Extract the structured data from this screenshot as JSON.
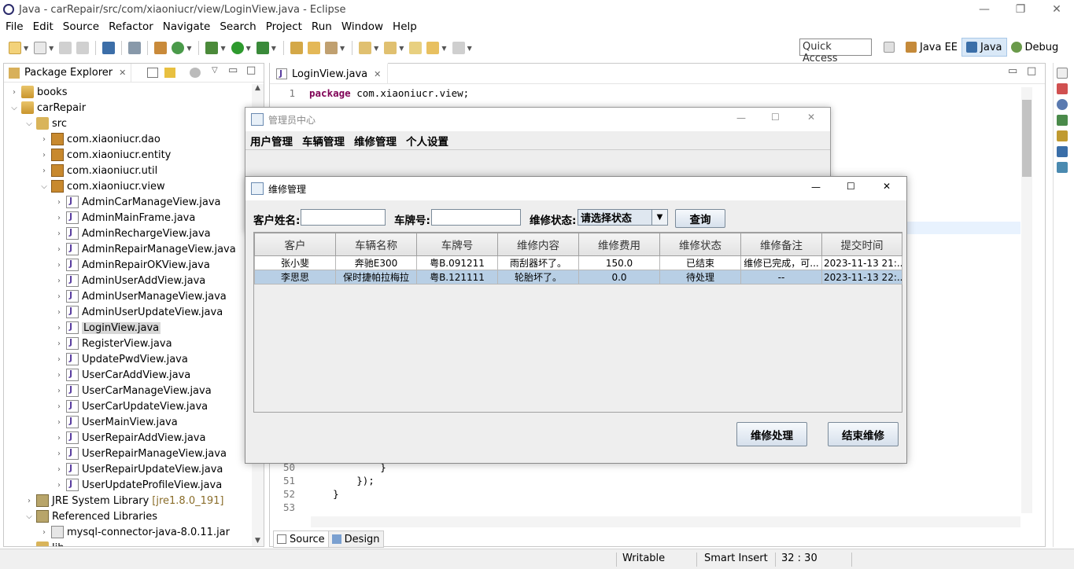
{
  "window": {
    "title": "Java - carRepair/src/com/xiaoniucr/view/LoginView.java - Eclipse"
  },
  "menu": [
    "File",
    "Edit",
    "Source",
    "Refactor",
    "Navigate",
    "Search",
    "Project",
    "Run",
    "Window",
    "Help"
  ],
  "quick_access": "Quick Access",
  "perspectives": [
    {
      "label": "Java EE",
      "active": false
    },
    {
      "label": "Java",
      "active": true
    },
    {
      "label": "Debug",
      "active": false
    }
  ],
  "package_explorer": {
    "title": "Package Explorer",
    "items": [
      {
        "label": "books",
        "depth": 0,
        "icon": "project",
        "expanded": false
      },
      {
        "label": "carRepair",
        "depth": 0,
        "icon": "project",
        "expanded": true
      },
      {
        "label": "src",
        "depth": 1,
        "icon": "source-folder",
        "expanded": true
      },
      {
        "label": "com.xiaoniucr.dao",
        "depth": 2,
        "icon": "package",
        "expanded": false
      },
      {
        "label": "com.xiaoniucr.entity",
        "depth": 2,
        "icon": "package",
        "expanded": false
      },
      {
        "label": "com.xiaoniucr.util",
        "depth": 2,
        "icon": "package",
        "expanded": false
      },
      {
        "label": "com.xiaoniucr.view",
        "depth": 2,
        "icon": "package",
        "expanded": true
      },
      {
        "label": "AdminCarManageView.java",
        "depth": 3,
        "icon": "java-file",
        "expanded": false
      },
      {
        "label": "AdminMainFrame.java",
        "depth": 3,
        "icon": "java-file",
        "expanded": false
      },
      {
        "label": "AdminRechargeView.java",
        "depth": 3,
        "icon": "java-file",
        "expanded": false
      },
      {
        "label": "AdminRepairManageView.java",
        "depth": 3,
        "icon": "java-file",
        "expanded": false
      },
      {
        "label": "AdminRepairOKView.java",
        "depth": 3,
        "icon": "java-file",
        "expanded": false
      },
      {
        "label": "AdminUserAddView.java",
        "depth": 3,
        "icon": "java-file",
        "expanded": false
      },
      {
        "label": "AdminUserManageView.java",
        "depth": 3,
        "icon": "java-file",
        "expanded": false
      },
      {
        "label": "AdminUserUpdateView.java",
        "depth": 3,
        "icon": "java-file",
        "expanded": false
      },
      {
        "label": "LoginView.java",
        "depth": 3,
        "icon": "java-file",
        "expanded": false,
        "selected": true
      },
      {
        "label": "RegisterView.java",
        "depth": 3,
        "icon": "java-file",
        "expanded": false
      },
      {
        "label": "UpdatePwdView.java",
        "depth": 3,
        "icon": "java-file",
        "expanded": false
      },
      {
        "label": "UserCarAddView.java",
        "depth": 3,
        "icon": "java-file",
        "expanded": false
      },
      {
        "label": "UserCarManageView.java",
        "depth": 3,
        "icon": "java-file",
        "expanded": false
      },
      {
        "label": "UserCarUpdateView.java",
        "depth": 3,
        "icon": "java-file",
        "expanded": false
      },
      {
        "label": "UserMainView.java",
        "depth": 3,
        "icon": "java-file",
        "expanded": false
      },
      {
        "label": "UserRepairAddView.java",
        "depth": 3,
        "icon": "java-file",
        "expanded": false
      },
      {
        "label": "UserRepairManageView.java",
        "depth": 3,
        "icon": "java-file",
        "expanded": false
      },
      {
        "label": "UserRepairUpdateView.java",
        "depth": 3,
        "icon": "java-file",
        "expanded": false
      },
      {
        "label": "UserUpdateProfileView.java",
        "depth": 3,
        "icon": "java-file",
        "expanded": false
      },
      {
        "label": "JRE System Library",
        "suffix": "[jre1.8.0_191]",
        "depth": 1,
        "icon": "library",
        "expanded": false
      },
      {
        "label": "Referenced Libraries",
        "depth": 1,
        "icon": "library",
        "expanded": true
      },
      {
        "label": "mysql-connector-java-8.0.11.jar",
        "depth": 2,
        "icon": "jar",
        "expanded": false
      },
      {
        "label": "lib",
        "depth": 1,
        "icon": "folder",
        "expanded": false
      }
    ]
  },
  "editor": {
    "tab": "LoginView.java",
    "lines": [
      {
        "no": "1",
        "text": "package com.xiaoniucr.view;",
        "kw": "package"
      },
      {
        "no": "50",
        "text": "            }",
        "kw": ""
      },
      {
        "no": "51",
        "text": "        });",
        "kw": ""
      },
      {
        "no": "52",
        "text": "    }",
        "kw": ""
      },
      {
        "no": "53",
        "text": "",
        "kw": ""
      }
    ],
    "bottom_tabs": [
      "Source",
      "Design"
    ]
  },
  "status": {
    "writable": "Writable",
    "insert_mode": "Smart Insert",
    "position": "32 : 30"
  },
  "admin_window": {
    "title": "管理员中心",
    "menu": [
      "用户管理",
      "车辆管理",
      "维修管理",
      "个人设置"
    ]
  },
  "repair_window": {
    "title": "维修管理",
    "labels": {
      "customer_name": "客户姓名:",
      "plate": "车牌号:",
      "status": "维修状态:"
    },
    "inputs": {
      "customer_name": "",
      "plate": ""
    },
    "status_select": "请选择状态",
    "query_button": "查询",
    "table": {
      "columns": [
        "客户",
        "车辆名称",
        "车牌号",
        "维修内容",
        "维修费用",
        "维修状态",
        "维修备注",
        "提交时间"
      ],
      "rows": [
        [
          "张小斐",
          "奔驰E300",
          "粤B.091211",
          "雨刮器坏了。",
          "150.0",
          "已结束",
          "维修已完成，可...",
          "2023-11-13 21:..."
        ],
        [
          "李思思",
          "保时捷帕拉梅拉",
          "粤B.121111",
          "轮胎坏了。",
          "0.0",
          "待处理",
          "--",
          "2023-11-13 22:..."
        ]
      ],
      "selected_row": 1
    },
    "buttons": {
      "process": "维修处理",
      "finish": "结束维修"
    }
  }
}
